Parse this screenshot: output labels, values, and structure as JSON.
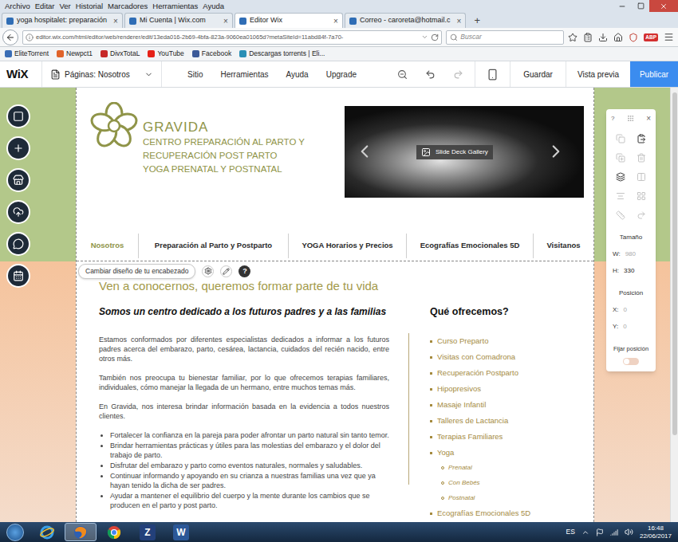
{
  "browser": {
    "menu": [
      "Archivo",
      "Editar",
      "Ver",
      "Historial",
      "Marcadores",
      "Herramientas",
      "Ayuda"
    ],
    "tabs": [
      {
        "label": "yoga hospitalet: preparación",
        "selected": false
      },
      {
        "label": "Mi Cuenta | Wix.com",
        "selected": false
      },
      {
        "label": "Editor Wix",
        "selected": true
      },
      {
        "label": "Correo - caroreta@hotmail.c",
        "selected": false
      }
    ],
    "tab_close": "×",
    "new_tab": "+",
    "address": {
      "url": "editor.wix.com/html/editor/web/renderer/edit/13eda016-2b69-4bfa-823a-9060ea01065d?metaSiteId=11abd84f-7a70-"
    },
    "search": {
      "placeholder": "Buscar"
    },
    "adblock_badge": "ABP",
    "bookmarks": [
      {
        "label": "EliteTorrent",
        "color": "#3a6db5"
      },
      {
        "label": "Newpct1",
        "color": "#e0632a"
      },
      {
        "label": "DivxTotaL",
        "color": "#c62828"
      },
      {
        "label": "YouTube",
        "color": "#e62117"
      },
      {
        "label": "Facebook",
        "color": "#3b5998"
      },
      {
        "label": "Descargas torrents | Eli...",
        "color": "#2a8fb5"
      }
    ]
  },
  "wix_bar": {
    "logo": "WiX",
    "pages": "Páginas: Nosotros",
    "menu": [
      "Sitio",
      "Herramientas",
      "Ayuda",
      "Upgrade"
    ],
    "save": "Guardar",
    "preview": "Vista previa",
    "publish": "Publicar"
  },
  "site": {
    "brand": "GRAVIDA",
    "tagline": [
      "CENTRO PREPARACIÓN AL PARTO Y",
      "RECUPERACIÓN POST PARTO",
      "YOGA PRENATAL Y POSTNATAL"
    ],
    "gallery_label": "Slide Deck Gallery",
    "nav": [
      {
        "label": "Nosotros",
        "selected": true
      },
      {
        "label": "Preparación al Parto y Postparto",
        "selected": false
      },
      {
        "label": "YOGA Horarios y Precios",
        "selected": false
      },
      {
        "label": "Ecografías Emocionales 5D",
        "selected": false
      },
      {
        "label": "Visitanos",
        "selected": false
      }
    ],
    "header_tooltip": {
      "label": "Cambiar diseño de tu encabezado",
      "help": "?"
    },
    "heading": "Ven a conocernos, queremos formar parte de tu vida",
    "intro_title": "Somos un centro dedicado a los futuros padres y a las familias",
    "paragraphs": [
      "Estamos conformados por diferentes especialistas dedicados a informar a los futuros padres acerca del embarazo, parto, cesárea, lactancia, cuidados del recién nacido, entre otros más.",
      "También nos preocupa tu bienestar familiar, por lo que ofrecemos terapias familiares, individuales, cómo manejar la llegada de un hermano, entre muchos temas más.",
      "En Gravida, nos interesa brindar información basada en la evidencia a todos nuestros clientes."
    ],
    "bullets": [
      "Fortalecer la confianza en la pareja para poder afrontar un parto natural sin tanto temor.",
      "Brindar herramientas prácticas y útiles para las molestias del embarazo y el dolor del trabajo de parto.",
      "Disfrutar del embarazo y parto como eventos naturales, normales y saludables.",
      "Continuar informando y apoyando en su crianza a nuestras familias una vez que ya hayan tenido la dicha de ser padres.",
      "Ayudar a mantener el equilibrio del cuerpo y la mente durante los cambios que se producen en el parto y post parto."
    ],
    "offers_title": "Qué ofrecemos?",
    "offers": [
      {
        "label": "Curso Preparto",
        "sub": []
      },
      {
        "label": "Visitas con Comadrona",
        "sub": []
      },
      {
        "label": "Recuperación Postparto",
        "sub": []
      },
      {
        "label": "Hipopresivos",
        "sub": []
      },
      {
        "label": "Masaje Infantil",
        "sub": []
      },
      {
        "label": "Talleres de Lactancia",
        "sub": []
      },
      {
        "label": "Terapias Familiares",
        "sub": []
      },
      {
        "label": "Yoga",
        "sub": [
          "Prenatal",
          "Con Bebés",
          "Postnatal"
        ]
      },
      {
        "label": "Ecografías Emocionales 5D",
        "sub": []
      }
    ]
  },
  "inspector": {
    "help": "?",
    "close": "×",
    "size_title": "Tamaño",
    "size": [
      {
        "label": "W:",
        "value": "980",
        "disabled": true
      },
      {
        "label": "H:",
        "value": "330",
        "disabled": false
      }
    ],
    "position_title": "Posición",
    "position": [
      {
        "label": "X:",
        "value": "0",
        "disabled": true
      },
      {
        "label": "Y:",
        "value": "0",
        "disabled": true
      }
    ],
    "pin_label": "Fijar posición",
    "pin_on": false
  },
  "taskbar": {
    "apps": [
      {
        "kind": "ie",
        "active": false
      },
      {
        "kind": "firefox",
        "active": true
      },
      {
        "kind": "chrome",
        "active": false
      },
      {
        "kind": "letter",
        "glyph": "Z",
        "color": "#23407a",
        "active": false
      },
      {
        "kind": "letter",
        "glyph": "W",
        "color": "#2b5797",
        "active": false
      }
    ],
    "lang": "ES",
    "time": "16:48",
    "date": "22/06/2017"
  }
}
